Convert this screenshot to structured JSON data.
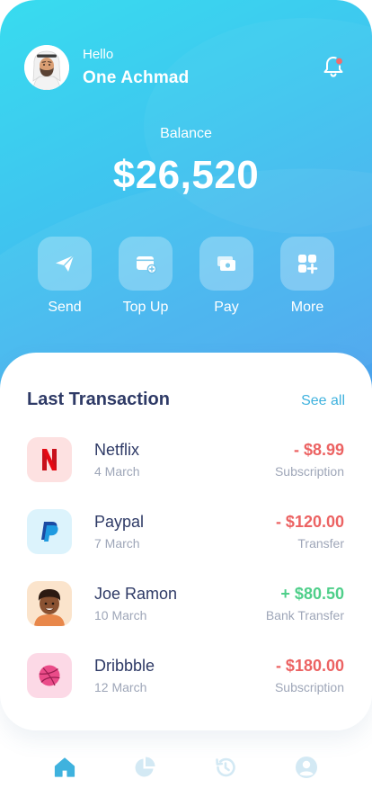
{
  "user": {
    "greeting": "Hello",
    "name": "One Achmad"
  },
  "balance": {
    "label": "Balance",
    "amount": "$26,520"
  },
  "actions": [
    {
      "label": "Send",
      "icon": "paper-plane-icon"
    },
    {
      "label": "Top Up",
      "icon": "wallet-plus-icon"
    },
    {
      "label": "Pay",
      "icon": "cash-icon"
    },
    {
      "label": "More",
      "icon": "grid-plus-icon"
    }
  ],
  "transactions": {
    "title": "Last Transaction",
    "see_all": "See all",
    "items": [
      {
        "name": "Netflix",
        "date": "4 March",
        "amount": "- $8.99",
        "type": "Subscription",
        "amount_color": "#ec6363",
        "icon": "netflix-logo-icon",
        "icon_bg": "#fde1e1"
      },
      {
        "name": "Paypal",
        "date": "7 March",
        "amount": "- $120.00",
        "type": "Transfer",
        "amount_color": "#ec6363",
        "icon": "paypal-logo-icon",
        "icon_bg": "#dcf3fc"
      },
      {
        "name": "Joe Ramon",
        "date": "10 March",
        "amount": "+ $80.50",
        "type": "Bank Transfer",
        "amount_color": "#4fcf8a",
        "icon": "person-avatar-icon",
        "icon_bg": "#fbe4cc"
      },
      {
        "name": "Dribbble",
        "date": "12 March",
        "amount": "- $180.00",
        "type": "Subscription",
        "amount_color": "#ec6363",
        "icon": "dribbble-logo-icon",
        "icon_bg": "#fcd9e6"
      }
    ]
  },
  "nav": [
    {
      "icon": "home-icon",
      "active": true
    },
    {
      "icon": "pie-chart-icon",
      "active": false
    },
    {
      "icon": "history-icon",
      "active": false
    },
    {
      "icon": "profile-icon",
      "active": false
    }
  ],
  "colors": {
    "accent": "#3fb2de",
    "header_top": "#38dcef",
    "header_bottom": "#4c9fee",
    "nav_inactive": "#d3e9f4",
    "notification_dot": "#f26b6b"
  }
}
